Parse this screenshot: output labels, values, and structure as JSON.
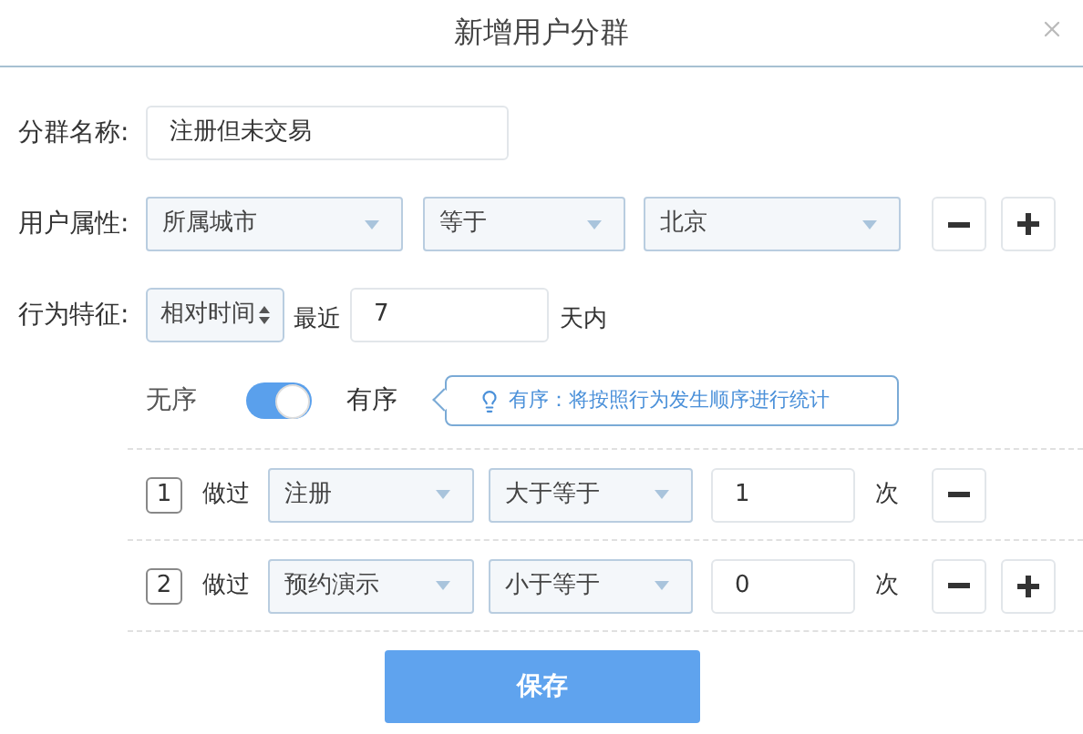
{
  "dialog": {
    "title": "新增用户分群"
  },
  "name_field": {
    "label": "分群名称:",
    "value": "注册但未交易"
  },
  "attribute": {
    "label": "用户属性:",
    "selects": [
      "所属城市",
      "等于",
      "北京"
    ],
    "buttons": [
      {
        "kind": "minus"
      },
      {
        "kind": "plus"
      }
    ]
  },
  "behavior": {
    "label": "行为特征:",
    "time_mode": "相对时间",
    "prefix": "最近",
    "value": "7",
    "suffix": "天内"
  },
  "order": {
    "off_label": "无序",
    "on_label": "有序",
    "on": true,
    "tip": "有序：将按照行为发生顺序进行统计"
  },
  "steps": [
    {
      "index": "1",
      "verb": "做过",
      "event": "注册",
      "operator": "大于等于",
      "count": "1",
      "unit": "次",
      "buttons": [
        {
          "kind": "minus"
        }
      ]
    },
    {
      "index": "2",
      "verb": "做过",
      "event": "预约演示",
      "operator": "小于等于",
      "count": "0",
      "unit": "次",
      "buttons": [
        {
          "kind": "minus"
        },
        {
          "kind": "plus"
        }
      ]
    }
  ],
  "save": "保存"
}
